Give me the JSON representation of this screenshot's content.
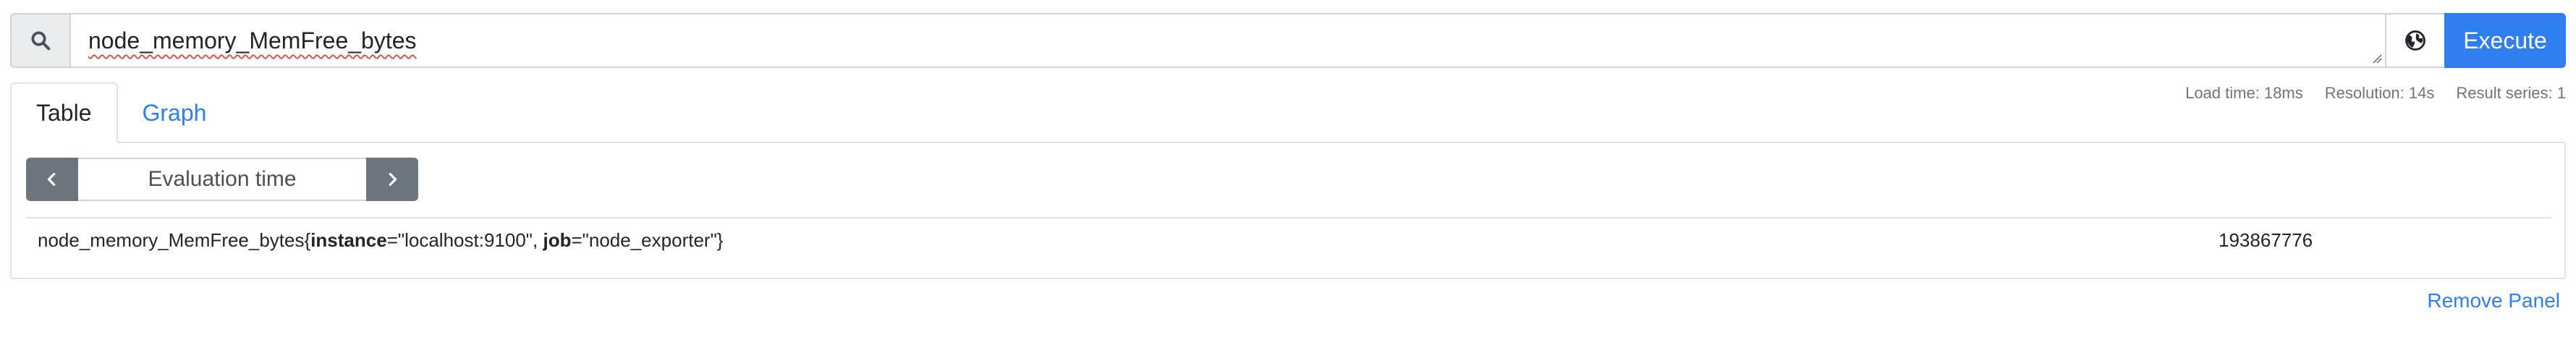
{
  "query": {
    "expression": "node_memory_MemFree_bytes",
    "execute_label": "Execute",
    "search_icon": "search-icon",
    "globe_icon": "globe-icon"
  },
  "tabs": [
    {
      "label": "Table",
      "active": true
    },
    {
      "label": "Graph",
      "active": false
    }
  ],
  "stats": {
    "load_time": "Load time: 18ms",
    "resolution": "Resolution: 14s",
    "result_series": "Result series: 1"
  },
  "panel": {
    "eval_time_placeholder": "Evaluation time",
    "prev_icon": "chevron-left-icon",
    "next_icon": "chevron-right-icon",
    "results": [
      {
        "metric_name": "node_memory_MemFree_bytes",
        "open_brace": "{",
        "label1_key": "instance",
        "label1_eq": "=",
        "label1_value": "\"localhost:9100\"",
        "sep": ", ",
        "label2_key": "job",
        "label2_eq": "=",
        "label2_value": "\"node_exporter\"",
        "close_brace": "}",
        "value": "193867776"
      }
    ]
  },
  "remove_panel_label": "Remove Panel",
  "colors": {
    "primary": "#2f7ef0",
    "secondary": "#6c757d",
    "border": "#dee2e6"
  }
}
